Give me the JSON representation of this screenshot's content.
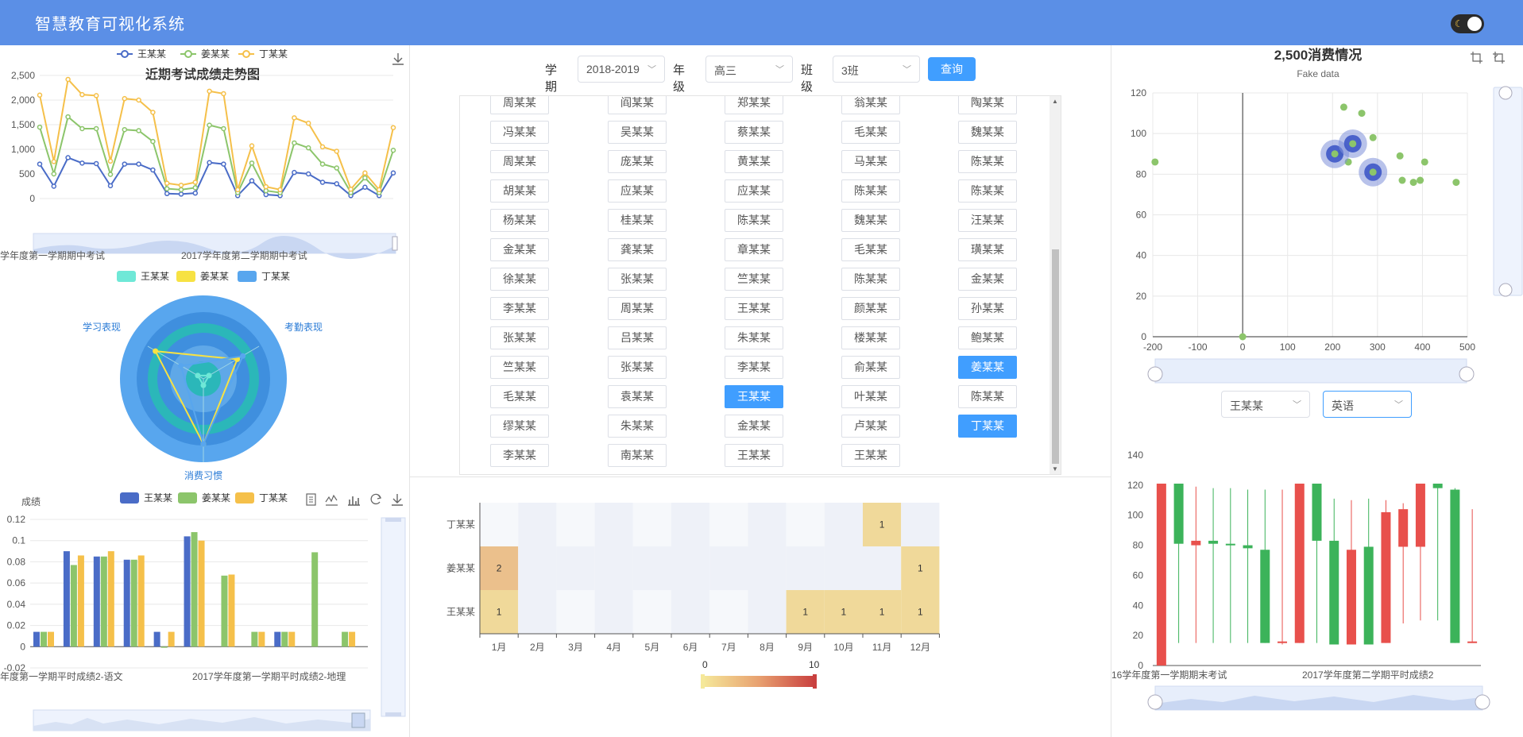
{
  "header": {
    "title": "智慧教育可视化系统",
    "theme_icon": "moon-icon"
  },
  "colors": {
    "header": "#5b8fe6",
    "blue": "#4a6cc7",
    "green": "#8cc56b",
    "yellow": "#f5c04a",
    "primary": "#409eff"
  },
  "trend_chart": {
    "title": "近期考试成绩走势图",
    "legend": [
      "王某某",
      "姜某某",
      "丁某某"
    ],
    "yticks": [
      "2,500",
      "2,000",
      "1,500",
      "1,000",
      "500",
      "0"
    ],
    "ylim": [
      0,
      2500
    ],
    "xlabels": [
      "学年度第一学期期中考试",
      "2017学年度第二学期期中考试"
    ],
    "series": [
      {
        "name": "王某某",
        "values": [
          700,
          250,
          830,
          720,
          710,
          260,
          700,
          700,
          580,
          100,
          90,
          110,
          730,
          700,
          60,
          360,
          80,
          60,
          530,
          500,
          330,
          300,
          60,
          230,
          60,
          520
        ]
      },
      {
        "name": "姜某某",
        "values": [
          1450,
          500,
          1660,
          1420,
          1420,
          490,
          1400,
          1380,
          1160,
          200,
          180,
          220,
          1490,
          1420,
          120,
          720,
          160,
          120,
          1130,
          1030,
          700,
          620,
          120,
          420,
          120,
          980
        ]
      },
      {
        "name": "丁某某",
        "values": [
          2100,
          750,
          2420,
          2110,
          2090,
          760,
          2030,
          2000,
          1750,
          310,
          270,
          330,
          2180,
          2130,
          180,
          1070,
          240,
          180,
          1640,
          1530,
          1050,
          960,
          190,
          520,
          180,
          1440
        ]
      }
    ]
  },
  "radar_chart": {
    "legend": [
      "王某某",
      "姜某某",
      "丁某某"
    ],
    "indicators": [
      "学习表现",
      "考勤表现",
      "消费习惯"
    ],
    "series": [
      {
        "name": "王某某",
        "values": [
          0.1,
          0.1,
          0.1
        ]
      },
      {
        "name": "姜某某",
        "values": [
          0.85,
          0.6,
          1.0
        ]
      },
      {
        "name": "丁某某",
        "values": [
          0.4,
          0.7,
          1.0
        ]
      }
    ]
  },
  "bar_chart": {
    "legend": [
      "王某某",
      "姜某某",
      "丁某某"
    ],
    "ylabel": "成绩",
    "yticks": [
      "0.12",
      "0.1",
      "0.08",
      "0.06",
      "0.04",
      "0.02",
      "0",
      "-0.02"
    ],
    "ylim": [
      -0.02,
      0.12
    ],
    "xlabels": [
      "年度第一学期平时成绩2-语文",
      "2017学年度第一学期平时成绩2-地理"
    ],
    "toolbox": [
      "data-view-icon",
      "line-chart-icon",
      "bar-chart-icon",
      "restore-icon",
      "download-icon"
    ],
    "series": [
      {
        "name": "王某某",
        "values": [
          0.014,
          0.09,
          0.085,
          0.082,
          0.014,
          0.104,
          0,
          0,
          0.014,
          0,
          0
        ]
      },
      {
        "name": "姜某某",
        "values": [
          0.014,
          0.077,
          0.085,
          0.082,
          -0.001,
          0.108,
          0.067,
          0.014,
          0.014,
          0.089,
          0.014
        ]
      },
      {
        "name": "丁某某",
        "values": [
          0.014,
          0.086,
          0.09,
          0.086,
          0.014,
          0.1,
          0.068,
          0.014,
          0.014,
          0,
          0.014
        ]
      }
    ]
  },
  "filters": {
    "term_label": "学期",
    "term_value": "2018-2019",
    "grade_label": "年级",
    "grade_value": "高三",
    "class_label": "班级",
    "class_value": "3班",
    "query_label": "查询"
  },
  "roster": [
    [
      "周某某",
      "阎某某",
      "郑某某",
      "翁某某",
      "陶某某"
    ],
    [
      "冯某某",
      "吴某某",
      "蔡某某",
      "毛某某",
      "魏某某"
    ],
    [
      "周某某",
      "庞某某",
      "黄某某",
      "马某某",
      "陈某某"
    ],
    [
      "胡某某",
      "应某某",
      "应某某",
      "陈某某",
      "陈某某"
    ],
    [
      "杨某某",
      "桂某某",
      "陈某某",
      "魏某某",
      "汪某某"
    ],
    [
      "金某某",
      "龚某某",
      "章某某",
      "毛某某",
      "璜某某"
    ],
    [
      "徐某某",
      "张某某",
      "竺某某",
      "陈某某",
      "金某某"
    ],
    [
      "李某某",
      "周某某",
      "王某某",
      "颜某某",
      "孙某某"
    ],
    [
      "张某某",
      "吕某某",
      "朱某某",
      "楼某某",
      "鲍某某"
    ],
    [
      "竺某某",
      "张某某",
      "李某某",
      "俞某某",
      "姜某某"
    ],
    [
      "毛某某",
      "袁某某",
      "王某某",
      "叶某某",
      "陈某某"
    ],
    [
      "缪某某",
      "朱某某",
      "金某某",
      "卢某某",
      "丁某某"
    ],
    [
      "李某某",
      "南某某",
      "王某某",
      "王某某"
    ]
  ],
  "roster_selected": [
    "9-4",
    "10-2",
    "11-4"
  ],
  "heatmap": {
    "rows": [
      "丁某某",
      "姜某某",
      "王某某"
    ],
    "months": [
      "1月",
      "2月",
      "3月",
      "4月",
      "5月",
      "6月",
      "7月",
      "8月",
      "9月",
      "10月",
      "11月",
      "12月"
    ],
    "values": [
      [
        0,
        0,
        0,
        0,
        0,
        0,
        0,
        0,
        0,
        0,
        1,
        0
      ],
      [
        2,
        0,
        0,
        0,
        0,
        0,
        0,
        0,
        0,
        0,
        0,
        1
      ],
      [
        1,
        0,
        0,
        0,
        0,
        0,
        0,
        0,
        1,
        1,
        1,
        1
      ]
    ],
    "labels": [
      [
        "",
        "",
        "",
        "",
        "",
        "",
        "",
        "",
        "",
        "",
        "1",
        ""
      ],
      [
        "2",
        "",
        "",
        "",
        "",
        "",
        "",
        "",
        "",
        "",
        "",
        "1"
      ],
      [
        "1",
        "",
        "",
        "",
        "",
        "",
        "",
        "",
        "1",
        "1",
        "1",
        "1"
      ]
    ],
    "scale_min": "0",
    "scale_max": "10"
  },
  "scatter_chart": {
    "title": "2,500消费情况",
    "subtitle": "Fake data",
    "xticks": [
      "-200",
      "-100",
      "0",
      "100",
      "200",
      "300",
      "400",
      "500"
    ],
    "yticks": [
      "120",
      "100",
      "80",
      "60",
      "40",
      "20",
      "0"
    ],
    "xlim": [
      -200,
      500
    ],
    "ylim": [
      0,
      120
    ],
    "points": [
      [
        -195,
        86
      ],
      [
        0,
        0
      ],
      [
        225,
        113
      ],
      [
        265,
        110
      ],
      [
        290,
        98
      ],
      [
        215,
        90
      ],
      [
        235,
        86
      ],
      [
        350,
        89
      ],
      [
        355,
        77
      ],
      [
        380,
        76
      ],
      [
        395,
        77
      ],
      [
        405,
        86
      ],
      [
        475,
        76
      ]
    ],
    "highlight_points": [
      [
        205,
        90
      ],
      [
        245,
        95
      ],
      [
        290,
        81
      ]
    ]
  },
  "student_select": "王某某",
  "subject_select": "英语",
  "candle_chart": {
    "yticks": [
      "140",
      "120",
      "100",
      "80",
      "60",
      "40",
      "20",
      "0"
    ],
    "ylim": [
      0,
      140
    ],
    "xlabels": [
      "16学年度第一学期期末考试",
      "2017学年度第二学期平时成绩2"
    ],
    "candles": [
      [
        0,
        121,
        0,
        121,
        1
      ],
      [
        121,
        81,
        15,
        121,
        0
      ],
      [
        83,
        80,
        15,
        119,
        1
      ],
      [
        81,
        83,
        15,
        118,
        0
      ],
      [
        81,
        80,
        15,
        118,
        0
      ],
      [
        80,
        78,
        15,
        117,
        0
      ],
      [
        77,
        15,
        15,
        117,
        0
      ],
      [
        16,
        15,
        14,
        117,
        1
      ],
      [
        15,
        121,
        15,
        121,
        1
      ],
      [
        121,
        83,
        15,
        121,
        0
      ],
      [
        83,
        14,
        14,
        111,
        0
      ],
      [
        14,
        77,
        14,
        110,
        1
      ],
      [
        79,
        14,
        14,
        111,
        0
      ],
      [
        15,
        102,
        15,
        110,
        1
      ],
      [
        79,
        104,
        28,
        108,
        1
      ],
      [
        79,
        121,
        30,
        121,
        1
      ],
      [
        121,
        118,
        30,
        121,
        0
      ],
      [
        117,
        15,
        15,
        118,
        0
      ],
      [
        15,
        16,
        15,
        104,
        1
      ]
    ]
  }
}
